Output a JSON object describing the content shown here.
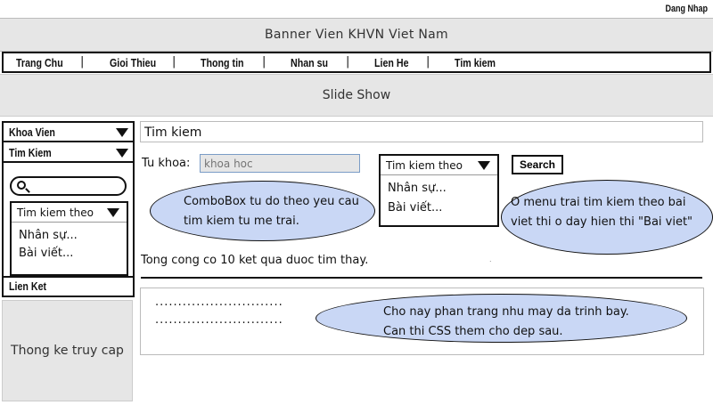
{
  "header": {
    "login_link": "Dang Nhap",
    "banner": "Banner Vien KHVN Viet Nam"
  },
  "nav": {
    "items": [
      "Trang Chu",
      "Gioi Thieu",
      "Thong tin",
      "Nhan su",
      "Lien He",
      "Tim kiem"
    ],
    "separator": "|"
  },
  "slideshow": "Slide Show",
  "sidebar": {
    "menu1": "Khoa Vien",
    "menu2": "Tim Kiem",
    "combo_label": "Tim kiem theo",
    "options": [
      "Nhân sự...",
      "Bài viết..."
    ],
    "links": "Lien Ket",
    "icons": {
      "search": "search-icon",
      "dropdown": "triangle-down-icon"
    }
  },
  "stats": "Thong ke truy cap",
  "main": {
    "title": "Tim kiem",
    "keyword_label": "Tu khoa:",
    "keyword_placeholder": "khoa hoc",
    "combo_label": "Tim kiem theo",
    "options": [
      "Nhân sự...",
      "Bài viết..."
    ],
    "search_button": "Search",
    "result_count": "Tong cong co 10 ket qua duoc tim thay.",
    "small_dot": ".",
    "result_lines": [
      "............................",
      "............................"
    ]
  },
  "notes": {
    "note1": [
      "ComboBox tu do theo yeu cau",
      "tim kiem tu me trai."
    ],
    "note2": [
      "O menu trai tim kiem theo bai",
      "viet thi o day hien thi \"Bai viet\""
    ],
    "note3": [
      "Cho nay phan trang nhu may da trinh bay.",
      "Can thi CSS them cho dep sau."
    ]
  },
  "colors": {
    "note_fill": "#c9d7f5",
    "panel_gray": "#e6e6e6",
    "input_border": "#7a9cc6"
  }
}
